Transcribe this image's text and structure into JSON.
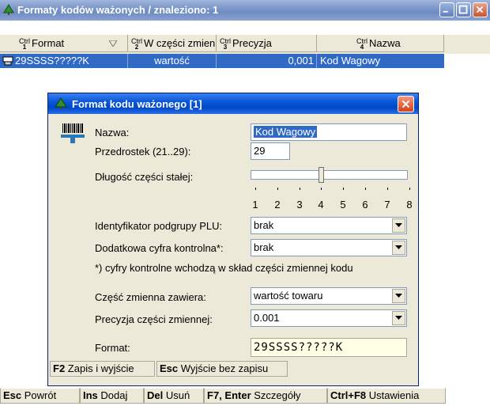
{
  "window": {
    "title": "Formaty kodów ważonych / znaleziono: 1"
  },
  "columns": [
    {
      "ctrl": "Ctrl",
      "num": "1",
      "label": "Format"
    },
    {
      "ctrl": "Ctrl",
      "num": "2",
      "label": "W części zmien"
    },
    {
      "ctrl": "Ctrl",
      "num": "3",
      "label": "Precyzja"
    },
    {
      "ctrl": "Ctrl",
      "num": "4",
      "label": "Nazwa"
    }
  ],
  "rows": [
    {
      "format": "29SSSS?????K",
      "part": "wartość",
      "precision": "0,001",
      "name": "Kod Wagowy"
    }
  ],
  "dialog": {
    "title": "Format kodu ważonego [1]",
    "name_label": "Nazwa:",
    "name_value": "Kod Wagowy",
    "prefix_label": "Przedrostek (21..29):",
    "prefix_value": "29",
    "length_label": "Długość części stałej:",
    "length_value": 4,
    "scale": [
      "1",
      "2",
      "3",
      "4",
      "5",
      "6",
      "7",
      "8"
    ],
    "plu_label": "Identyfikator podgrupy PLU:",
    "plu_value": "brak",
    "check_label": "Dodatkowa cyfra kontrolna*:",
    "check_value": "brak",
    "note": "*) cyfry kontrolne wchodzą w skład części zmiennej kodu",
    "variable_label": "Część zmienna zawiera:",
    "variable_value": "wartość towaru",
    "precision_label": "Precyzja części zmiennej:",
    "precision_value": "0.001",
    "format_label": "Format:",
    "format_value": "29SSSS?????K",
    "footer": [
      {
        "key": "F2",
        "label": "Zapis i wyjście"
      },
      {
        "key": "Esc",
        "label": "Wyjście bez zapisu"
      }
    ]
  },
  "statusbar": [
    {
      "key": "Esc",
      "label": "Powrót"
    },
    {
      "key": "Ins",
      "label": "Dodaj"
    },
    {
      "key": "Del",
      "label": "Usuń"
    },
    {
      "key": "F7, Enter",
      "label": "Szczegóły"
    },
    {
      "key": "Ctrl+F8",
      "label": "Ustawienia"
    }
  ],
  "colors": {
    "selection": "#316ac5",
    "dialog_face": "#ece9d8",
    "format_field": "#ffffe6"
  }
}
